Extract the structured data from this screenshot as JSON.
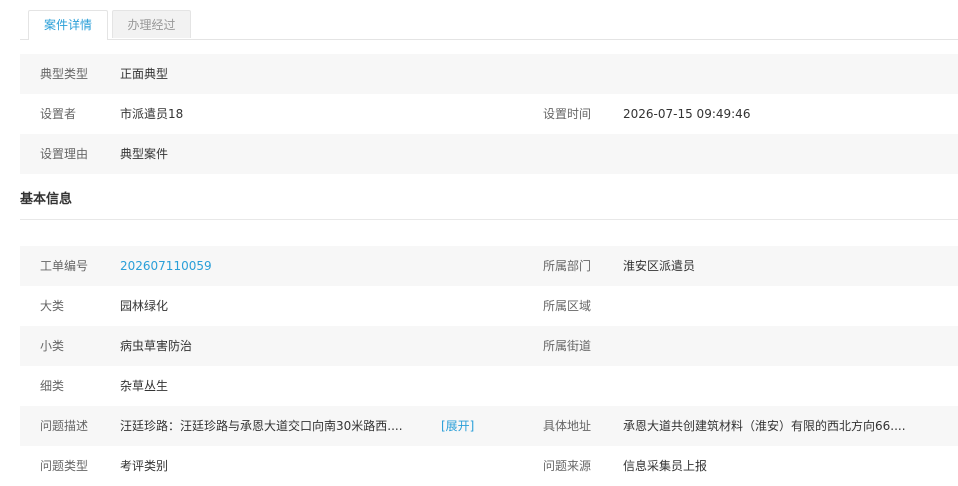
{
  "tabs": [
    {
      "label": "案件详情",
      "active": true
    },
    {
      "label": "办理经过",
      "active": false
    }
  ],
  "typical": {
    "type_label": "典型类型",
    "type_value": "正面典型",
    "setter_label": "设置者",
    "setter_value": "市派遣员18",
    "time_label": "设置时间",
    "time_value": "2026-07-15 09:49:46",
    "reason_label": "设置理由",
    "reason_value": "典型案件"
  },
  "basic": {
    "title": "基本信息",
    "order_no_label": "工单编号",
    "order_no_value": "202607110059",
    "dept_label": "所属部门",
    "dept_value": "淮安区派遣员",
    "category_label": "大类",
    "category_value": "园林绿化",
    "region_label": "所属区域",
    "region_value": "",
    "subcategory_label": "小类",
    "subcategory_value": "病虫草害防治",
    "street_label": "所属街道",
    "street_value": "",
    "detail_label": "细类",
    "detail_value": "杂草丛生",
    "desc_label": "问题描述",
    "desc_value": "汪廷珍路：汪廷珍路与承恩大道交口向南30米路西....",
    "expand_label": "[展开]",
    "address_label": "具体地址",
    "address_value": "承恩大道共创建筑材料（淮安）有限的西北方向66....",
    "issue_type_label": "问题类型",
    "issue_type_value": "考评类别",
    "source_label": "问题来源",
    "source_value": "信息采集员上报"
  },
  "colors": {
    "accent": "#2a9fd8",
    "row_shade": "#f7f7f7",
    "label": "#666666"
  }
}
